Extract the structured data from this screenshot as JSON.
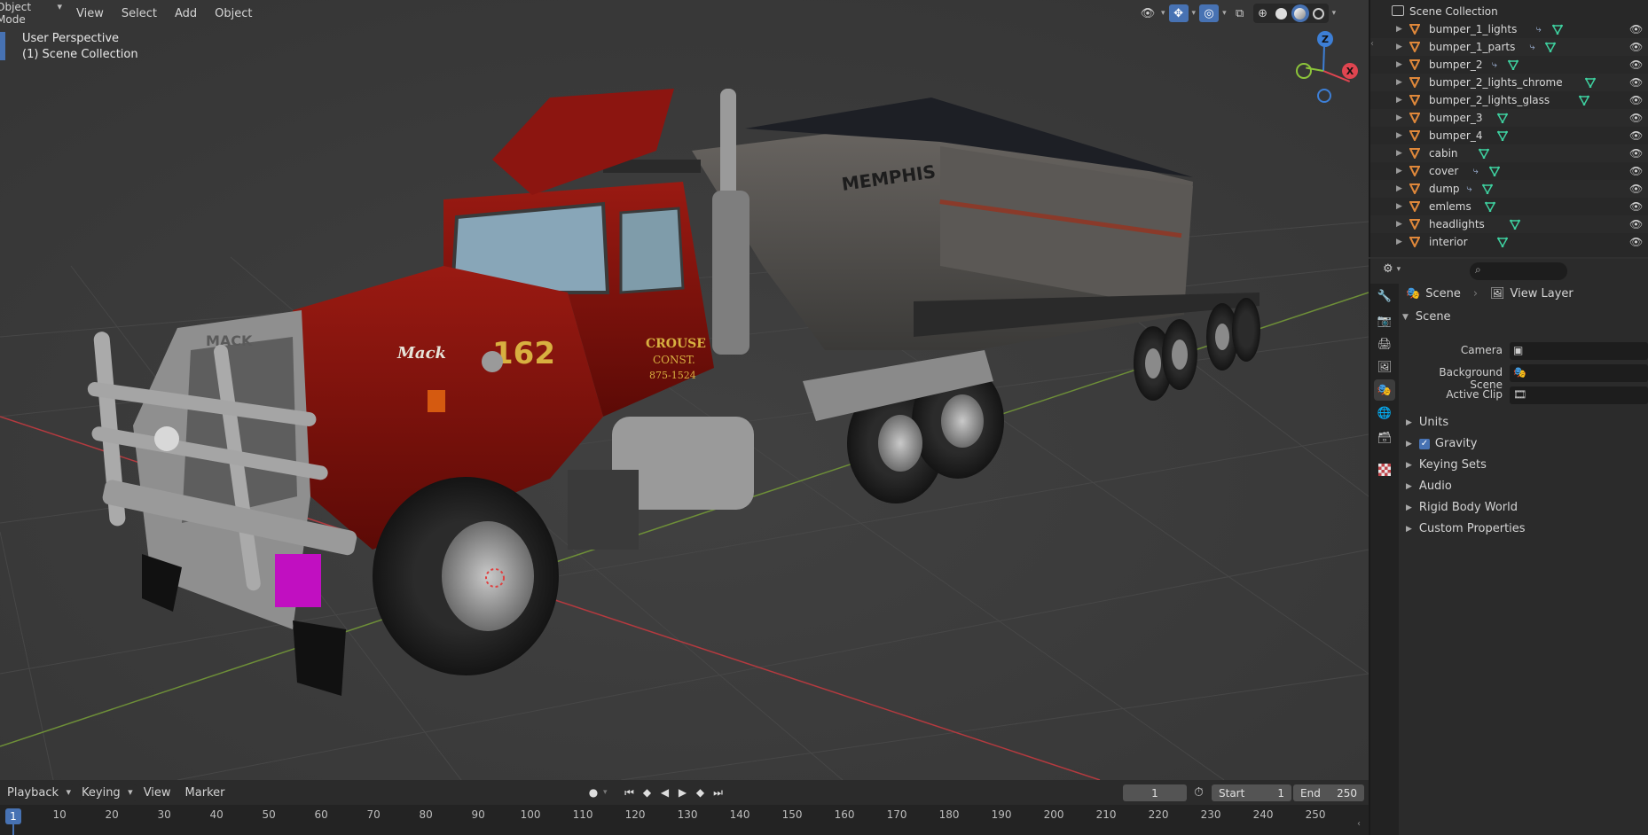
{
  "viewport": {
    "mode_label": "Object Mode",
    "menus": [
      "View",
      "Select",
      "Add",
      "Object"
    ],
    "perspective_label": "User Perspective",
    "collection_label": "(1) Scene Collection",
    "gizmo": {
      "x": "X",
      "y": "Y",
      "z": "Z"
    },
    "truck_text": {
      "brand": "Mack",
      "number": "162",
      "company": "CROUSE",
      "const": "CONST.",
      "phone": "875-1524",
      "grille": "MACK",
      "dump": "MEMPHIS"
    }
  },
  "timeline": {
    "menus": [
      "Playback",
      "Keying",
      "View",
      "Marker"
    ],
    "current_frame": "1",
    "start_label": "Start",
    "start_value": "1",
    "end_label": "End",
    "end_value": "250",
    "ticks": [
      "10",
      "20",
      "30",
      "40",
      "50",
      "60",
      "70",
      "80",
      "90",
      "100",
      "110",
      "120",
      "130",
      "140",
      "150",
      "160",
      "170",
      "180",
      "190",
      "200",
      "210",
      "220",
      "230",
      "240",
      "250"
    ],
    "playhead": "1"
  },
  "outliner": {
    "root": "Scene Collection",
    "items": [
      {
        "name": "bumper_1_lights",
        "mod": true
      },
      {
        "name": "bumper_1_parts",
        "mod": true
      },
      {
        "name": "bumper_2",
        "mod": true
      },
      {
        "name": "bumper_2_lights_chrome",
        "mod": false
      },
      {
        "name": "bumper_2_lights_glass",
        "mod": false
      },
      {
        "name": "bumper_3",
        "mod": false
      },
      {
        "name": "bumper_4",
        "mod": false
      },
      {
        "name": "cabin",
        "mod": false
      },
      {
        "name": "cover",
        "mod": true
      },
      {
        "name": "dump",
        "mod": true
      },
      {
        "name": "emlems",
        "mod": false
      },
      {
        "name": "headlights",
        "mod": false
      },
      {
        "name": "interior",
        "mod": false
      }
    ]
  },
  "properties": {
    "breadcrumb_scene": "Scene",
    "breadcrumb_view_layer": "View Layer",
    "panel_title": "Scene",
    "fields": [
      {
        "label": "Camera"
      },
      {
        "label": "Background Scene"
      },
      {
        "label": "Active Clip"
      }
    ],
    "subpanels": [
      "Units",
      "Gravity",
      "Keying Sets",
      "Audio",
      "Rigid Body World",
      "Custom Properties"
    ]
  },
  "colors": {
    "accent": "#4772b3",
    "mesh_icon": "#e0883a",
    "axis_x": "#e04550",
    "axis_y": "#8cc43a",
    "axis_z": "#3d7fd6"
  }
}
